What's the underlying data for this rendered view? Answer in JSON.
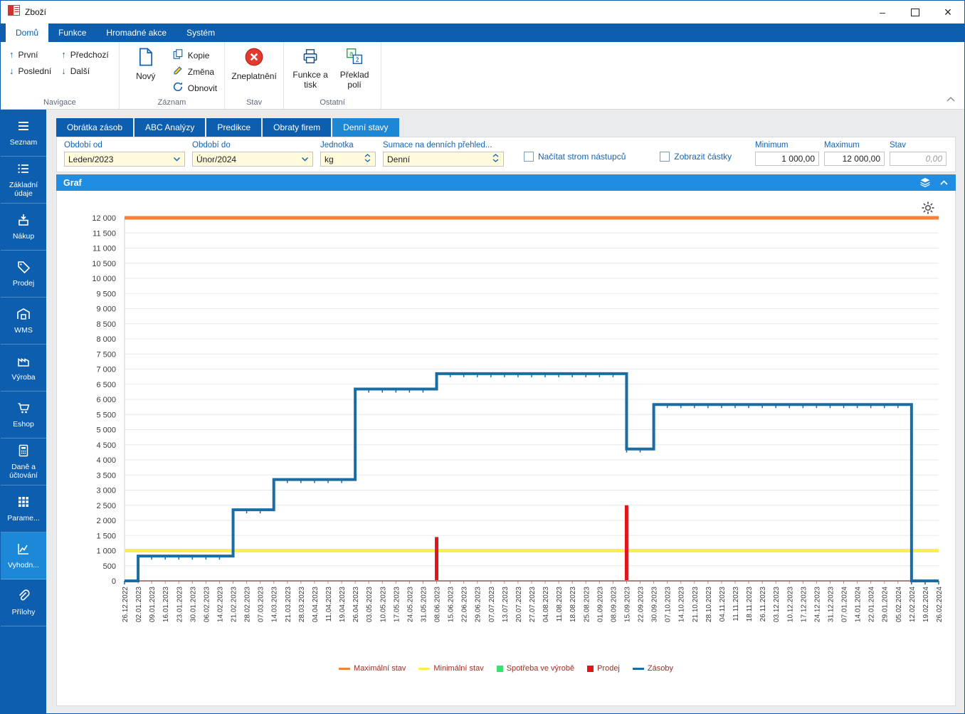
{
  "window": {
    "title": "Zboží"
  },
  "ribbon": {
    "tabs": [
      {
        "label": "Domů",
        "active": true
      },
      {
        "label": "Funkce",
        "active": false
      },
      {
        "label": "Hromadné akce",
        "active": false
      },
      {
        "label": "Systém",
        "active": false
      }
    ],
    "navigace": {
      "label": "Navigace",
      "first": "První",
      "last": "Poslední",
      "prev": "Předchozí",
      "next": "Další"
    },
    "zaznam": {
      "label": "Záznam",
      "new": "Nový",
      "copy": "Kopie",
      "change": "Změna",
      "refresh": "Obnovit"
    },
    "stav": {
      "label": "Stav",
      "invalidate": "Zneplatnění"
    },
    "ostatni": {
      "label": "Ostatní",
      "functions_print": "Funkce a tisk",
      "field_translation": "Překlad polí"
    }
  },
  "sidebar": {
    "active_index": 9,
    "items": [
      {
        "label": "Seznam"
      },
      {
        "label": "Základní údaje"
      },
      {
        "label": "Nákup"
      },
      {
        "label": "Prodej"
      },
      {
        "label": "WMS"
      },
      {
        "label": "Výroba"
      },
      {
        "label": "Eshop"
      },
      {
        "label": "Daně a účtování"
      },
      {
        "label": "Parame..."
      },
      {
        "label": "Vyhodn..."
      },
      {
        "label": "Přílohy"
      }
    ]
  },
  "tabs": [
    {
      "label": "Obrátka zásob",
      "active": false
    },
    {
      "label": "ABC Analýzy",
      "active": false
    },
    {
      "label": "Predikce",
      "active": false
    },
    {
      "label": "Obraty firem",
      "active": false
    },
    {
      "label": "Denní stavy",
      "active": true
    }
  ],
  "filters": {
    "period_from": {
      "label": "Období od",
      "value": "Leden/2023"
    },
    "period_to": {
      "label": "Období do",
      "value": "Únor/2024"
    },
    "unit": {
      "label": "Jednotka",
      "value": "kg"
    },
    "summation": {
      "label": "Sumace na denních přehled...",
      "value": "Denní"
    },
    "load_successors": {
      "label": "Načítat strom nástupců",
      "checked": false
    },
    "show_amounts": {
      "label": "Zobrazit částky",
      "checked": false
    },
    "minimum": {
      "label": "Minimum",
      "value": "1 000,00"
    },
    "maximum": {
      "label": "Maximum",
      "value": "12 000,00"
    },
    "stav": {
      "label": "Stav",
      "value": "0,00"
    }
  },
  "graf": {
    "title": "Graf"
  },
  "chart_data": {
    "type": "line",
    "title": "Graf",
    "ylim": [
      0,
      12000
    ],
    "ytick_step": 500,
    "grid": "horizontal",
    "legend_position": "bottom",
    "x_labels": [
      "26.12.2022",
      "02.01.2023",
      "09.01.2023",
      "16.01.2023",
      "23.01.2023",
      "30.01.2023",
      "06.02.2023",
      "14.02.2023",
      "21.02.2023",
      "28.02.2023",
      "07.03.2023",
      "14.03.2023",
      "21.03.2023",
      "28.03.2023",
      "04.04.2023",
      "11.04.2023",
      "19.04.2023",
      "26.04.2023",
      "03.05.2023",
      "10.05.2023",
      "17.05.2023",
      "24.05.2023",
      "31.05.2023",
      "08.06.2023",
      "15.06.2023",
      "22.06.2023",
      "29.06.2023",
      "07.07.2023",
      "13.07.2023",
      "20.07.2023",
      "27.07.2023",
      "04.08.2023",
      "11.08.2023",
      "18.08.2023",
      "25.08.2023",
      "01.09.2023",
      "08.09.2023",
      "15.09.2023",
      "22.09.2023",
      "30.09.2023",
      "07.10.2023",
      "14.10.2023",
      "21.10.2023",
      "28.10.2023",
      "04.11.2023",
      "11.11.2023",
      "18.11.2023",
      "26.11.2023",
      "03.12.2023",
      "10.12.2023",
      "17.12.2023",
      "24.12.2023",
      "31.12.2023",
      "07.01.2024",
      "14.01.2024",
      "22.01.2024",
      "29.01.2024",
      "05.02.2024",
      "12.02.2024",
      "19.02.2024",
      "26.02.2024"
    ],
    "series": [
      {
        "name": "Maximální stav",
        "kind": "hline",
        "value": 12000,
        "color": "#f5823a",
        "swatch": "dash"
      },
      {
        "name": "Minimální stav",
        "kind": "hline",
        "value": 1000,
        "color": "#fbee4f",
        "swatch": "dash"
      },
      {
        "name": "Spotřeba ve výrobě",
        "kind": "bar",
        "color": "#39e273",
        "swatch": "square",
        "points": []
      },
      {
        "name": "Prodej",
        "kind": "bar",
        "color": "#e2161a",
        "swatch": "square",
        "points": [
          {
            "x": "08.06.2023",
            "y": 1450
          },
          {
            "x": "15.09.2023",
            "y": 2500
          }
        ]
      },
      {
        "name": "Zásoby",
        "kind": "step",
        "color": "#1b6ca3",
        "swatch": "dash",
        "points": [
          {
            "x": "26.12.2022",
            "y": 0
          },
          {
            "x": "02.01.2023",
            "y": 820
          },
          {
            "x": "21.02.2023",
            "y": 2350
          },
          {
            "x": "14.03.2023",
            "y": 3350
          },
          {
            "x": "26.04.2023",
            "y": 6340
          },
          {
            "x": "08.06.2023",
            "y": 6850
          },
          {
            "x": "15.09.2023",
            "y": 4360
          },
          {
            "x": "30.09.2023",
            "y": 5830
          },
          {
            "x": "12.02.2024",
            "y": 0
          }
        ]
      }
    ]
  }
}
